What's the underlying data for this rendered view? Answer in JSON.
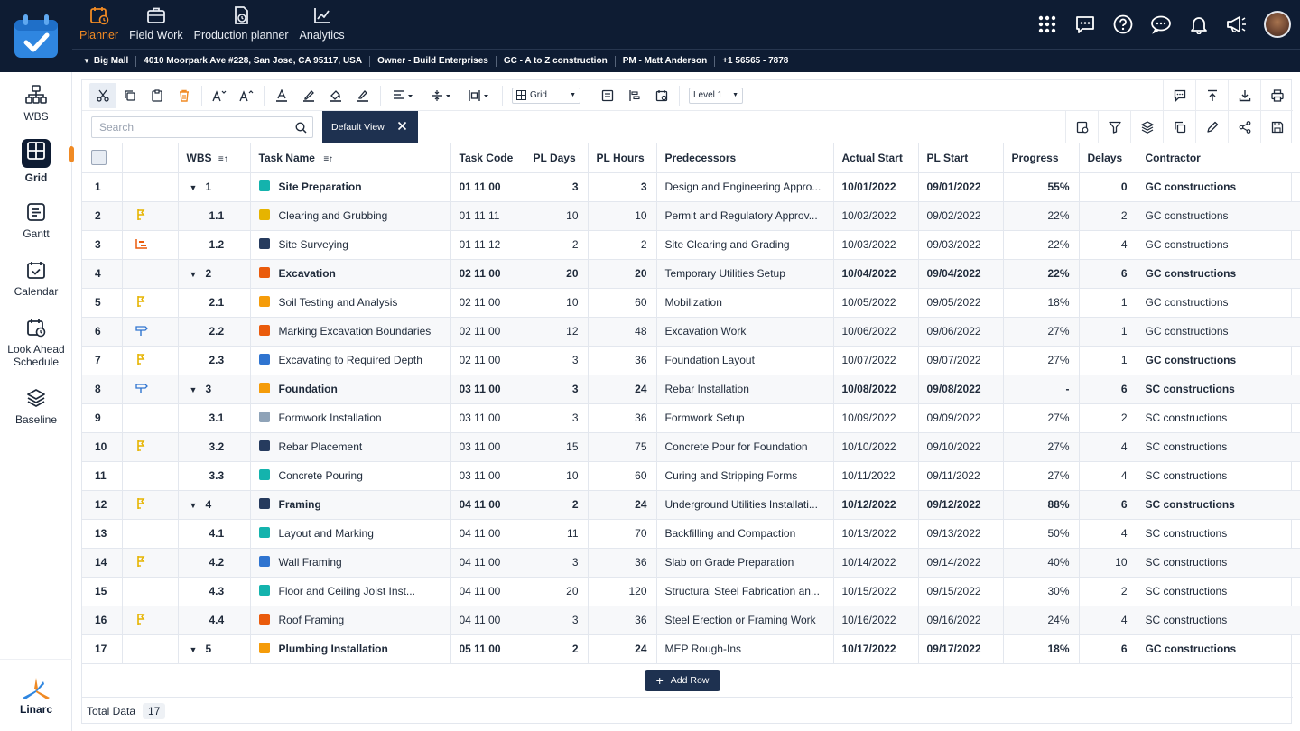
{
  "nav": {
    "items": [
      {
        "label": "Planner",
        "icon": "planner-icon",
        "active": true
      },
      {
        "label": "Field Work",
        "icon": "briefcase-icon"
      },
      {
        "label": "Production planner",
        "icon": "production-planner-icon"
      },
      {
        "label": "Analytics",
        "icon": "analytics-icon"
      }
    ]
  },
  "infobar": {
    "project": "Big Mall",
    "address": "4010 Moorpark Ave #228, San Jose, CA 95117, USA",
    "owner": "Owner - Build Enterprises",
    "gc": "GC - A to Z construction",
    "pm": "PM -  Matt Anderson",
    "phone": "+1 56565 - 7878"
  },
  "sidebar": {
    "items": [
      {
        "label": "WBS"
      },
      {
        "label": "Grid",
        "active": true
      },
      {
        "label": "Gantt"
      },
      {
        "label": "Calendar"
      },
      {
        "label": "Look Ahead Schedule"
      },
      {
        "label": "Baseline"
      }
    ],
    "brand": "Linarc"
  },
  "toolbar": {
    "view_select": "Grid",
    "level_select": "Level 1"
  },
  "search": {
    "placeholder": "Search"
  },
  "view_chip": {
    "label": "Default View"
  },
  "table": {
    "columns": [
      "WBS",
      "Task Name",
      "Task Code",
      "PL Days",
      "PL Hours",
      "Predecessors",
      "Actual Start",
      "PL Start",
      "Progress",
      "Delays",
      "Contractor"
    ],
    "rows": [
      {
        "n": "1",
        "flag": "",
        "wbs": "1",
        "parent": true,
        "color": "#14b3ad",
        "name": "Site Preparation",
        "code": "01 11 00",
        "days": "3",
        "hours": "3",
        "pred": "Design and Engineering Appro...",
        "astart": "10/01/2022",
        "plstart": "09/01/2022",
        "progress": "55%",
        "delays": "0",
        "contractor": "GC constructions",
        "bold": true,
        "cbold": true
      },
      {
        "n": "2",
        "flag": "pin",
        "wbs": "1.1",
        "color": "#e6b400",
        "name": "Clearing and Grubbing",
        "code": "01 11 11",
        "days": "10",
        "hours": "10",
        "pred": "Permit and Regulatory Approv...",
        "astart": "10/02/2022",
        "plstart": "09/02/2022",
        "progress": "22%",
        "delays": "2",
        "contractor": "GC constructions"
      },
      {
        "n": "3",
        "flag": "chart",
        "wbs": "1.2",
        "color": "#263b5e",
        "name": "Site Surveying",
        "code": "01 11 12",
        "days": "2",
        "hours": "2",
        "pred": "Site Clearing and Grading",
        "astart": "10/03/2022",
        "plstart": "09/03/2022",
        "progress": "22%",
        "delays": "4",
        "contractor": "GC constructions"
      },
      {
        "n": "4",
        "flag": "",
        "wbs": "2",
        "parent": true,
        "color": "#ea5b0c",
        "name": "Excavation",
        "code": "02 11 00",
        "days": "20",
        "hours": "20",
        "pred": "Temporary Utilities Setup",
        "astart": "10/04/2022",
        "plstart": "09/04/2022",
        "progress": "22%",
        "delays": "6",
        "contractor": "GC constructions",
        "bold": true,
        "cbold": true
      },
      {
        "n": "5",
        "flag": "pin",
        "wbs": "2.1",
        "color": "#f59c0a",
        "name": "Soil Testing and Analysis",
        "code": "02 11 00",
        "days": "10",
        "hours": "60",
        "pred": "Mobilization",
        "astart": "10/05/2022",
        "plstart": "09/05/2022",
        "progress": "18%",
        "delays": "1",
        "contractor": "GC constructions"
      },
      {
        "n": "6",
        "flag": "sign",
        "wbs": "2.2",
        "color": "#ea5b0c",
        "name": "Marking Excavation Boundaries",
        "code": "02 11 00",
        "days": "12",
        "hours": "48",
        "pred": "Excavation Work",
        "astart": "10/06/2022",
        "plstart": "09/06/2022",
        "progress": "27%",
        "delays": "1",
        "contractor": "GC constructions"
      },
      {
        "n": "7",
        "flag": "pin",
        "wbs": "2.3",
        "color": "#2f74d0",
        "name": "Excavating to Required Depth",
        "code": "02 11 00",
        "days": "3",
        "hours": "36",
        "pred": "Foundation Layout",
        "astart": "10/07/2022",
        "plstart": "09/07/2022",
        "progress": "27%",
        "delays": "1",
        "contractor": "GC constructions",
        "cbold": true
      },
      {
        "n": "8",
        "flag": "sign",
        "wbs": "3",
        "parent": true,
        "color": "#f59c0a",
        "name": "Foundation",
        "code": "03 11 00",
        "days": "3",
        "hours": "24",
        "pred": "Rebar Installation",
        "astart": "10/08/2022",
        "plstart": "09/08/2022",
        "progress": "-",
        "delays": "6",
        "contractor": "SC constructions",
        "bold": true,
        "cbold": true
      },
      {
        "n": "9",
        "flag": "",
        "wbs": "3.1",
        "color": "#8fa3b8",
        "name": "Formwork Installation",
        "code": "03 11 00",
        "days": "3",
        "hours": "36",
        "pred": "Formwork Setup",
        "astart": "10/09/2022",
        "plstart": "09/09/2022",
        "progress": "27%",
        "delays": "2",
        "contractor": "SC constructions"
      },
      {
        "n": "10",
        "flag": "pin",
        "wbs": "3.2",
        "color": "#263b5e",
        "name": "Rebar Placement",
        "code": "03 11 00",
        "days": "15",
        "hours": "75",
        "pred": "Concrete Pour for Foundation",
        "astart": "10/10/2022",
        "plstart": "09/10/2022",
        "progress": "27%",
        "delays": "4",
        "contractor": "SC constructions"
      },
      {
        "n": "11",
        "flag": "",
        "wbs": "3.3",
        "color": "#14b3ad",
        "name": "Concrete Pouring",
        "code": "03 11 00",
        "days": "10",
        "hours": "60",
        "pred": "Curing and Stripping Forms",
        "astart": "10/11/2022",
        "plstart": "09/11/2022",
        "progress": "27%",
        "delays": "4",
        "contractor": "SC constructions"
      },
      {
        "n": "12",
        "flag": "pin",
        "wbs": "4",
        "parent": true,
        "color": "#263b5e",
        "name": "Framing",
        "code": "04 11 00",
        "days": "2",
        "hours": "24",
        "pred": "Underground Utilities Installati...",
        "astart": "10/12/2022",
        "plstart": "09/12/2022",
        "progress": "88%",
        "delays": "6",
        "contractor": "SC constructions",
        "bold": true,
        "cbold": true
      },
      {
        "n": "13",
        "flag": "",
        "wbs": "4.1",
        "color": "#14b3ad",
        "name": "Layout and Marking",
        "code": "04 11 00",
        "days": "11",
        "hours": "70",
        "pred": "Backfilling and Compaction",
        "astart": "10/13/2022",
        "plstart": "09/13/2022",
        "progress": "50%",
        "delays": "4",
        "contractor": "SC constructions"
      },
      {
        "n": "14",
        "flag": "pin",
        "wbs": "4.2",
        "color": "#2f74d0",
        "name": "Wall Framing",
        "code": "04 11 00",
        "days": "3",
        "hours": "36",
        "pred": "Slab on Grade Preparation",
        "astart": "10/14/2022",
        "plstart": "09/14/2022",
        "progress": "40%",
        "delays": "10",
        "contractor": "SC constructions"
      },
      {
        "n": "15",
        "flag": "",
        "wbs": "4.3",
        "color": "#14b3ad",
        "name": "Floor and Ceiling Joist Inst...",
        "code": "04 11 00",
        "days": "20",
        "hours": "120",
        "pred": "Structural Steel Fabrication an...",
        "astart": "10/15/2022",
        "plstart": "09/15/2022",
        "progress": "30%",
        "delays": "2",
        "contractor": "SC constructions"
      },
      {
        "n": "16",
        "flag": "pin",
        "wbs": "4.4",
        "color": "#ea5b0c",
        "name": "Roof Framing",
        "code": "04 11 00",
        "days": "3",
        "hours": "36",
        "pred": "Steel Erection or Framing Work",
        "astart": "10/16/2022",
        "plstart": "09/16/2022",
        "progress": "24%",
        "delays": "4",
        "contractor": "SC constructions"
      },
      {
        "n": "17",
        "flag": "",
        "wbs": "5",
        "parent": true,
        "color": "#f59c0a",
        "name": "Plumbing Installation",
        "code": "05 11 00",
        "days": "2",
        "hours": "24",
        "pred": "MEP Rough-Ins",
        "astart": "10/17/2022",
        "plstart": "09/17/2022",
        "progress": "18%",
        "delays": "6",
        "contractor": "GC constructions",
        "bold": true,
        "cbold": true
      }
    ]
  },
  "footer": {
    "add_row": "Add Row",
    "total_label": "Total Data",
    "total_count": "17"
  }
}
